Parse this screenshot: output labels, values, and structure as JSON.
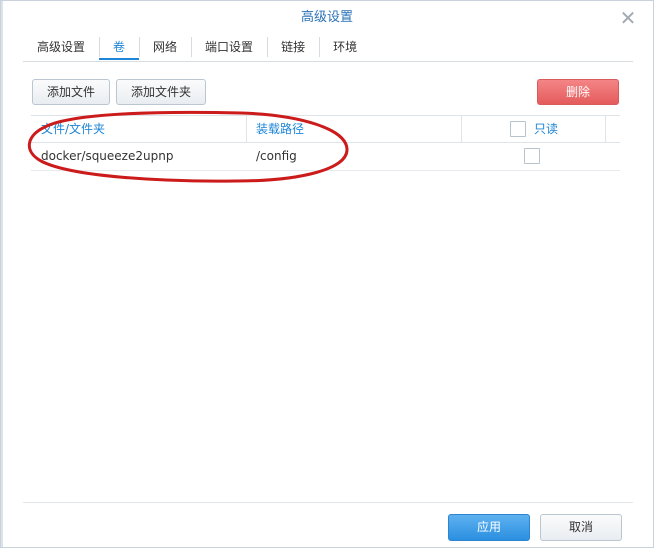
{
  "dialog": {
    "title": "高级设置",
    "close_icon": "close-icon"
  },
  "tabs": [
    {
      "label": "高级设置",
      "active": false
    },
    {
      "label": "卷",
      "active": true
    },
    {
      "label": "网络",
      "active": false
    },
    {
      "label": "端口设置",
      "active": false
    },
    {
      "label": "链接",
      "active": false
    },
    {
      "label": "环境",
      "active": false
    }
  ],
  "toolbar": {
    "add_file_label": "添加文件",
    "add_folder_label": "添加文件夹",
    "delete_label": "删除"
  },
  "table": {
    "columns": [
      "文件/文件夹",
      "装载路径",
      "只读"
    ],
    "rows": [
      {
        "file": "docker/squeeze2upnp",
        "mount_path": "/config",
        "readonly": false
      }
    ]
  },
  "footer": {
    "apply_label": "应用",
    "cancel_label": "取消"
  },
  "colors": {
    "accent": "#1d85d6",
    "danger": "#e45b5c",
    "annotation": "#cc1b1b"
  }
}
